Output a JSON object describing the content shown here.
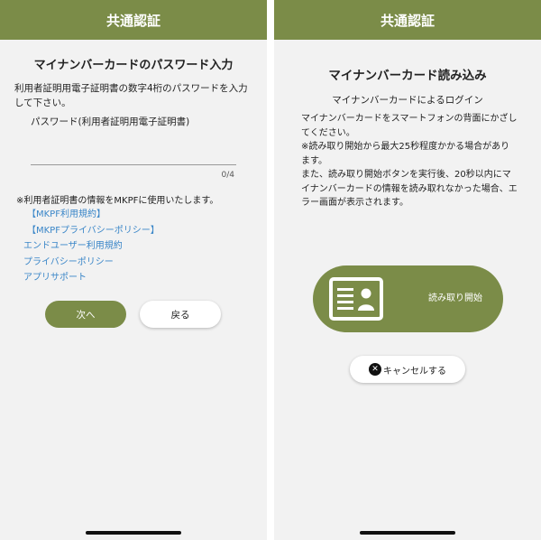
{
  "left": {
    "header_title": "共通認証",
    "title": "マイナンバーカードのパスワード入力",
    "description": "利用者証明用電子証明書の数字4桁のパスワードを入力して下さい。",
    "password_label": "パスワード(利用者証明用電子証明書)",
    "password_value": "",
    "counter": "0/4",
    "note": "※利用者証明書の情報をMKPFに使用いたします。",
    "links": [
      "【MKPF利用規約】",
      "【MKPFプライバシーポリシー】",
      "エンドユーザー利用規約",
      "プライバシーポリシー",
      "アプリサポート"
    ],
    "next_label": "次へ",
    "back_label": "戻る"
  },
  "right": {
    "header_title": "共通認証",
    "title": "マイナンバーカード読み込み",
    "subtitle": "マイナンバーカードによるログイン",
    "body": [
      "マイナンバーカードをスマートフォンの背面にかざしてください。",
      "※読み取り開始から最大25秒程度かかる場合があります。",
      "また、読み取り開始ボタンを実行後、20秒以内にマイナンバーカードの情報を読み取れなかった場合、エラー画面が表示されます。"
    ],
    "read_button_label": "読み取り開始",
    "cancel_label": "キャンセルする"
  },
  "colors": {
    "accent": "#7b8c48",
    "link": "#3a86c8",
    "background": "#f2f2f2"
  },
  "icons": {
    "read_button": "id-card-icon",
    "cancel": "close-circle-icon"
  }
}
